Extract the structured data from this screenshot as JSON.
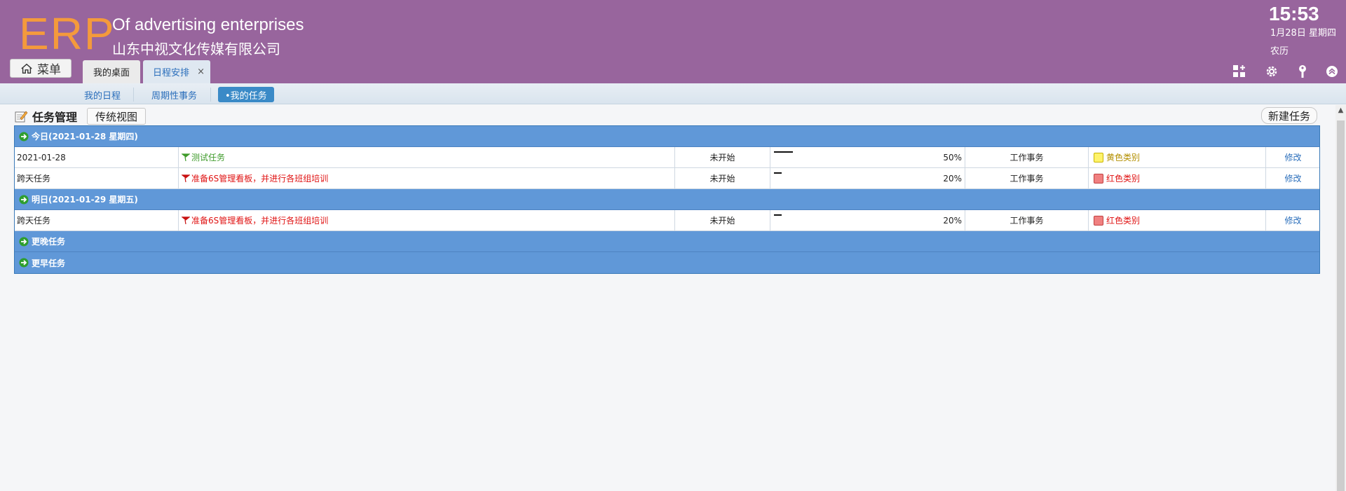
{
  "header": {
    "logo": "ERP",
    "company_en": "Of advertising enterprises",
    "company_cn": "山东中视文化传媒有限公司",
    "clock": "15:53",
    "date": "1月28日 星期四",
    "lunar": "农历",
    "menu_label": "菜单",
    "icons": [
      "grid-add-icon",
      "gear-icon",
      "key-icon",
      "collapse-up-icon"
    ]
  },
  "tabs": [
    {
      "label": "我的桌面",
      "active": false
    },
    {
      "label": "日程安排",
      "active": true,
      "close": "×"
    }
  ],
  "subnav": {
    "items": [
      {
        "label": "我的日程",
        "active": false
      },
      {
        "label": "周期性事务",
        "active": false
      },
      {
        "label": "•我的任务",
        "active": true
      }
    ]
  },
  "page": {
    "title": "任务管理",
    "view_button": "传统视图",
    "new_button": "新建任务"
  },
  "groups": [
    {
      "label": "今日(2021-01-28 星期四)",
      "rows": [
        {
          "date": "2021-01-28",
          "name": "测试任务",
          "name_color": "#3f9b2b",
          "flag_color": "#3f9b2b",
          "status": "未开始",
          "progress_text": "50%",
          "progress": 0.5,
          "type": "工作事务",
          "category": "黄色类别",
          "category_color": "#fff36a",
          "category_text_color": "#b38f00",
          "edit": "修改"
        },
        {
          "date": "跨天任务",
          "name": "准备6S管理看板，并进行各班组培训",
          "name_color": "#e01414",
          "flag_color": "#c81010",
          "status": "未开始",
          "progress_text": "20%",
          "progress": 0.2,
          "type": "工作事务",
          "category": "红色类别",
          "category_color": "#f08080",
          "category_text_color": "#e01414",
          "edit": "修改"
        }
      ]
    },
    {
      "label": "明日(2021-01-29 星期五)",
      "rows": [
        {
          "date": "跨天任务",
          "name": "准备6S管理看板，并进行各班组培训",
          "name_color": "#e01414",
          "flag_color": "#c81010",
          "status": "未开始",
          "progress_text": "20%",
          "progress": 0.2,
          "type": "工作事务",
          "category": "红色类别",
          "category_color": "#f08080",
          "category_text_color": "#e01414",
          "edit": "修改"
        }
      ]
    },
    {
      "label": "更晚任务",
      "rows": []
    },
    {
      "label": "更早任务",
      "rows": []
    }
  ],
  "colors": {
    "header_bg": "#98659d",
    "logo": "#f49a3c",
    "group_bg": "#6098d8",
    "link": "#2a6ebb"
  }
}
